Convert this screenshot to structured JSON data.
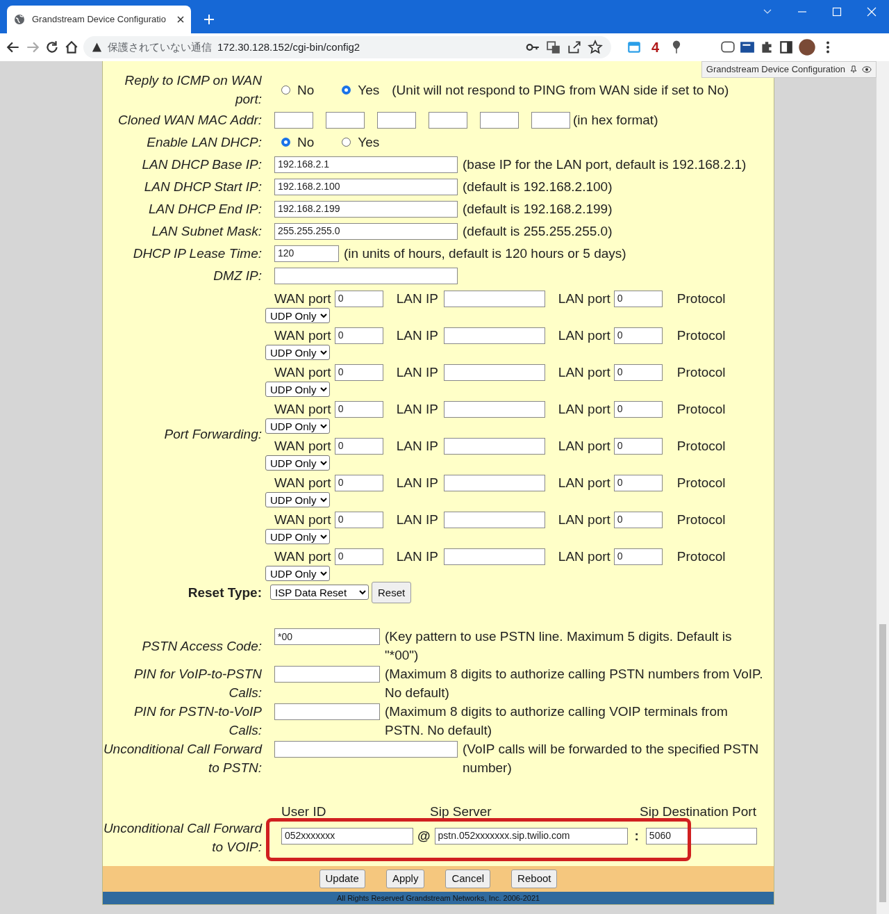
{
  "browser": {
    "tab_title": "Grandstream Device Configuratio",
    "security_label": "保護されていない通信",
    "url": "172.30.128.152/cgi-bin/config2",
    "extension_badge": "4",
    "tooltip": "Grandstream Device Configuration"
  },
  "rows": [
    {
      "kind": "radio",
      "label": "Reply to ICMP on WAN port:",
      "options": [
        {
          "label": "No",
          "selected": false
        },
        {
          "label": "Yes",
          "selected": true
        }
      ],
      "note": "(Unit will not respond to PING from WAN side if set to No)"
    },
    {
      "kind": "mac",
      "label": "Cloned WAN MAC Addr:",
      "note": "(in hex format)"
    },
    {
      "kind": "radio",
      "label": "Enable LAN DHCP:",
      "options": [
        {
          "label": "No",
          "selected": true
        },
        {
          "label": "Yes",
          "selected": false
        }
      ]
    },
    {
      "kind": "ip",
      "label": "LAN DHCP Base IP:",
      "value": "192.168.2.1",
      "note": "(base IP for the LAN port, default is 192.168.2.1)"
    },
    {
      "kind": "ip",
      "label": "LAN DHCP Start IP:",
      "value": "192.168.2.100",
      "note": "(default is 192.168.2.100)"
    },
    {
      "kind": "ip",
      "label": "LAN DHCP End IP:",
      "value": "192.168.2.199",
      "note": "(default is 192.168.2.199)"
    },
    {
      "kind": "ip",
      "label": "LAN Subnet Mask:",
      "value": "255.255.255.0",
      "note": "(default is 255.255.255.0)"
    },
    {
      "kind": "number",
      "label": "DHCP IP Lease Time:",
      "value": "120",
      "note": "(in units of hours, default is 120 hours or 5 days)"
    },
    {
      "kind": "ip",
      "label": "DMZ IP:"
    },
    {
      "kind": "ports",
      "label": "Port Forwarding:",
      "entries": [
        {
          "wan_label": "WAN port",
          "wan_port": "0",
          "lan_ip_label": "LAN IP",
          "lan_port_label": "LAN port",
          "lan_port": "0",
          "protocol_label": "Protocol",
          "protocol": "UDP Only"
        },
        {
          "wan_label": "WAN port",
          "wan_port": "0",
          "lan_ip_label": "LAN IP",
          "lan_port_label": "LAN port",
          "lan_port": "0",
          "protocol_label": "Protocol",
          "protocol": "UDP Only"
        },
        {
          "wan_label": "WAN port",
          "wan_port": "0",
          "lan_ip_label": "LAN IP",
          "lan_port_label": "LAN port",
          "lan_port": "0",
          "protocol_label": "Protocol",
          "protocol": "UDP Only"
        },
        {
          "wan_label": "WAN port",
          "wan_port": "0",
          "lan_ip_label": "LAN IP",
          "lan_port_label": "LAN port",
          "lan_port": "0",
          "protocol_label": "Protocol",
          "protocol": "UDP Only"
        },
        {
          "wan_label": "WAN port",
          "wan_port": "0",
          "lan_ip_label": "LAN IP",
          "lan_port_label": "LAN port",
          "lan_port": "0",
          "protocol_label": "Protocol",
          "protocol": "UDP Only"
        },
        {
          "wan_label": "WAN port",
          "wan_port": "0",
          "lan_ip_label": "LAN IP",
          "lan_port_label": "LAN port",
          "lan_port": "0",
          "protocol_label": "Protocol",
          "protocol": "UDP Only"
        },
        {
          "wan_label": "WAN port",
          "wan_port": "0",
          "lan_ip_label": "LAN IP",
          "lan_port_label": "LAN port",
          "lan_port": "0",
          "protocol_label": "Protocol",
          "protocol": "UDP Only"
        },
        {
          "wan_label": "WAN port",
          "wan_port": "0",
          "lan_ip_label": "LAN IP",
          "lan_port_label": "LAN port",
          "lan_port": "0",
          "protocol_label": "Protocol",
          "protocol": "UDP Only"
        }
      ]
    },
    {
      "kind": "reset",
      "label": "Reset Type:",
      "select": "ISP Data Reset",
      "button": "Reset"
    },
    {
      "kind": "code",
      "label": "PSTN Access Code:",
      "value": "*00",
      "note": "(Key pattern to use PSTN line. Maximum 5 digits. Default is \"*00\")"
    },
    {
      "kind": "code",
      "label": "PIN for VoIP-to-PSTN Calls:",
      "note": "(Maximum 8 digits to authorize calling PSTN numbers from VoIP.  No default)"
    },
    {
      "kind": "code",
      "label": "PIN for PSTN-to-VoIP Calls:",
      "note": "(Maximum 8 digits to authorize calling VOIP terminals from PSTN.  No default)"
    },
    {
      "kind": "phone",
      "label": "Unconditional Call Forward to PSTN:",
      "note": "(VoIP calls will be forwarded to the specified PSTN number)"
    },
    {
      "kind": "voip",
      "label": "Unconditional Call Forward to VOIP:",
      "headers": [
        "User ID",
        "Sip Server",
        "Sip Destination Port"
      ],
      "user_id": "052xxxxxxx",
      "at": "@",
      "sip_server": "pstn.052xxxxxxx.sip.twilio.com",
      "colon": ":",
      "port": "5060",
      "highlighted": true
    }
  ],
  "footer": {
    "buttons": [
      "Update",
      "Apply",
      "Cancel",
      "Reboot"
    ],
    "copyright": "All Rights Reserved Grandstream Networks, Inc. 2006-2021"
  }
}
